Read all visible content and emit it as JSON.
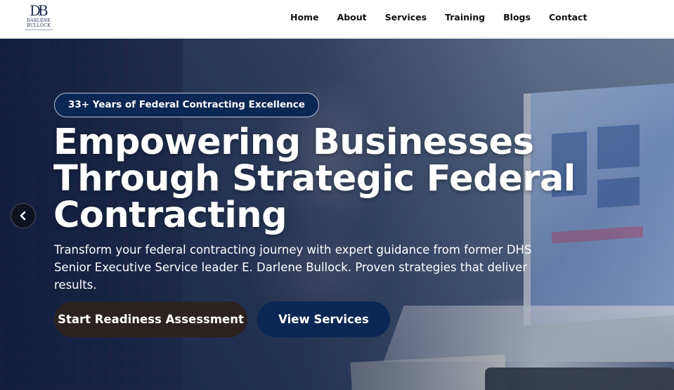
{
  "brand": {
    "monogram": "DB",
    "name_line1": "DARLENE",
    "name_line2": "BULLOCK"
  },
  "nav": {
    "items": [
      {
        "label": "Home"
      },
      {
        "label": "About"
      },
      {
        "label": "Services"
      },
      {
        "label": "Training"
      },
      {
        "label": "Blogs"
      },
      {
        "label": "Contact"
      }
    ]
  },
  "hero": {
    "badge": "33+ Years of Federal Contracting Excellence",
    "headline_lines": [
      "Empowering Businesses",
      "Through Strategic Federal",
      "Contracting"
    ],
    "subtext": "Transform your federal contracting journey with expert guidance from former DHS Senior Executive Service leader E. Darlene Bullock. Proven strategies that deliver results.",
    "primary_cta": "Start Readiness Assessment",
    "secondary_cta": "View Services",
    "prev_icon": "chevron-left-icon"
  },
  "colors": {
    "navy": "#0c2753",
    "dark_button": "#2a2320",
    "text_white": "#ffffff",
    "nav_text": "#111111"
  }
}
